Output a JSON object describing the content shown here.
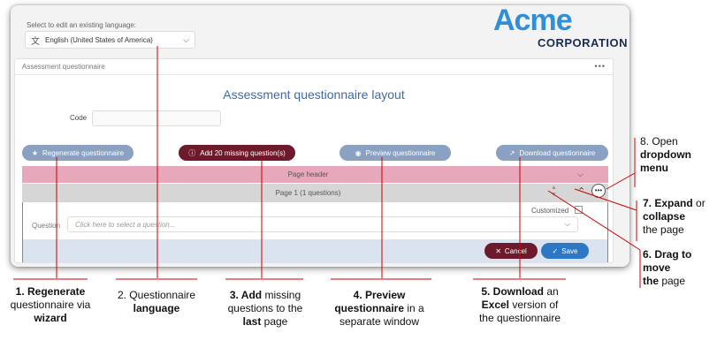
{
  "language": {
    "label": "Select to edit an existing language:",
    "selected": "English (United States of America)"
  },
  "logo": {
    "big": "Acme",
    "corp": "CORPORATION"
  },
  "panel": {
    "title": "Assessment questionnaire",
    "menu": "•••",
    "layout_title": "Assessment questionnaire layout",
    "code_label": "Code",
    "code_value": ""
  },
  "buttons": {
    "regenerate": "Regenerate questionnaire",
    "add_missing": "Add 20 missing question(s)",
    "preview": "Preview questionnaire",
    "download": "Download questionnaire"
  },
  "rows": {
    "page_header": "Page header",
    "page1": "Page 1 (1 questions)"
  },
  "question": {
    "customized_label": "Customized",
    "label": "Question",
    "placeholder": "Click here to select a question...",
    "cancel": "Cancel",
    "save": "Save"
  },
  "annotations": {
    "n1": {
      "bold1": "1. Regenerate",
      "text": "questionnaire via",
      "bold2": "wizard"
    },
    "n2": {
      "text": "2. Questionnaire",
      "bold": "language"
    },
    "n3": {
      "bold1": "3. Add",
      "text1": " missing",
      "text2": "questions to the",
      "bold2": "last",
      "text3": " page"
    },
    "n4": {
      "bold1": "4. Preview",
      "bold2": "questionnaire",
      "text1": " in a",
      "text2": "separate window"
    },
    "n5": {
      "bold1": "5. Download",
      "text1": " an",
      "bold2": "Excel",
      "text2": " version of",
      "text3": "the questionnaire"
    },
    "n6": {
      "bold1": "6. Drag to",
      "bold2": "move",
      "bold3": "the",
      "text": " page"
    },
    "n7": {
      "bold1": "7. Expand",
      "text1": " or",
      "bold2": "collapse",
      "text2": "the page"
    },
    "n8": {
      "text": "8. Open",
      "bold1": "dropdown",
      "bold2": "menu"
    }
  },
  "colors": {
    "accent": "#6e1a2d",
    "button": "#8aa1c2",
    "save": "#2d78c5",
    "annotation_line": "#cc0000",
    "page_header_row": "#e8a8bc"
  }
}
